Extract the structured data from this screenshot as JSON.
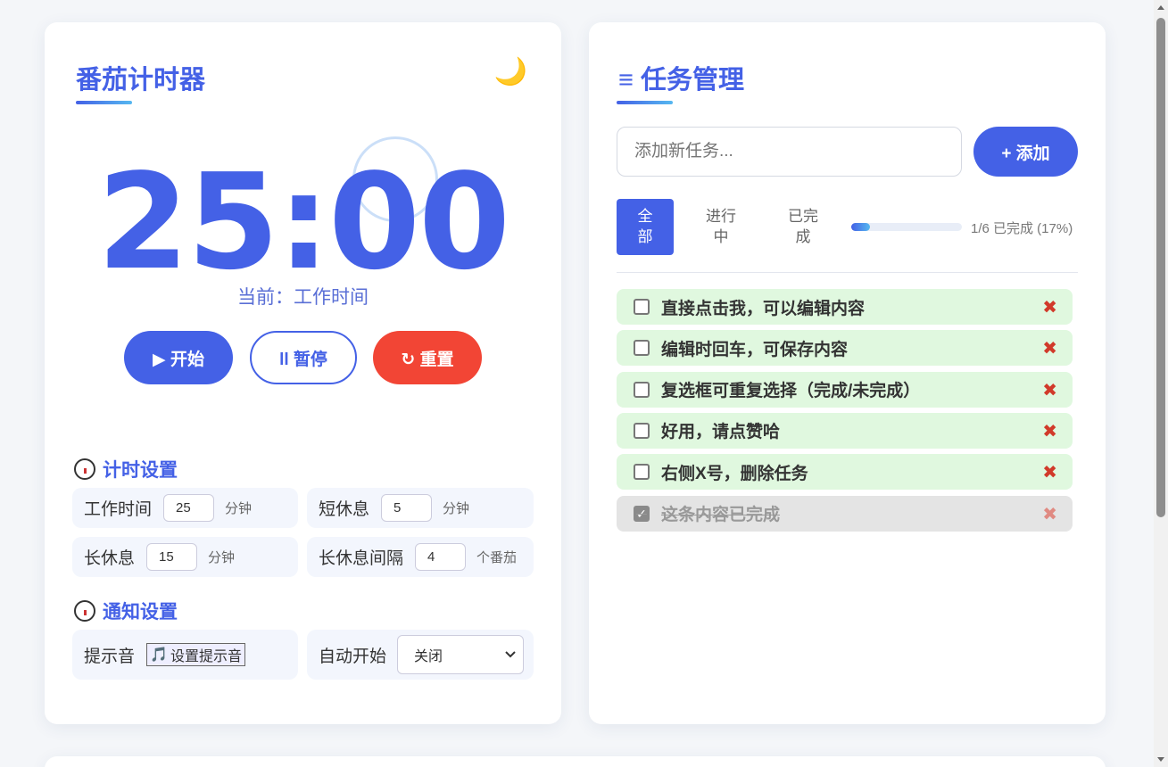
{
  "timer": {
    "title": "番茄计时器",
    "theme_icon": "🌙",
    "time": "25:00",
    "phase": "当前：工作时间",
    "start_label": "▶ 开始",
    "pause_label": "ll 暂停",
    "reset_label": "↻ 重置"
  },
  "timer_settings": {
    "title": "计时设置",
    "work_label": "工作时间",
    "work_value": "25",
    "work_unit": "分钟",
    "short_label": "短休息",
    "short_value": "5",
    "short_unit": "分钟",
    "long_label": "长休息",
    "long_value": "15",
    "long_unit": "分钟",
    "interval_label": "长休息间隔",
    "interval_value": "4",
    "interval_unit": "个番茄"
  },
  "notify_settings": {
    "title": "通知设置",
    "sound_label": "提示音",
    "sound_button": "设置提示音",
    "sound_icon": "🎵",
    "auto_label": "自动开始",
    "auto_value": "关闭"
  },
  "tasks": {
    "title": "≡ 任务管理",
    "input_placeholder": "添加新任务...",
    "add_label": "+ 添加",
    "filters": [
      {
        "label": "全\n部",
        "active": true
      },
      {
        "label": "进行\n中",
        "active": false
      },
      {
        "label": "已完\n成",
        "active": false
      }
    ],
    "progress_fraction": 0.17,
    "progress_text": "1/6 已完成 (17%)",
    "items": [
      {
        "text": "直接点击我，可以编辑内容",
        "done": false
      },
      {
        "text": "编辑时回车，可保存内容",
        "done": false
      },
      {
        "text": "复选框可重复选择（完成/未完成）",
        "done": false
      },
      {
        "text": "好用，请点赞哈",
        "done": false
      },
      {
        "text": "右侧X号，删除任务",
        "done": false
      },
      {
        "text": "这条内容已完成",
        "done": true
      }
    ],
    "delete_icon": "✖"
  },
  "colors": {
    "accent": "#4461e6",
    "danger": "#f24535",
    "task_bg": "#e0f8df",
    "done_bg": "#e4e4e4"
  }
}
